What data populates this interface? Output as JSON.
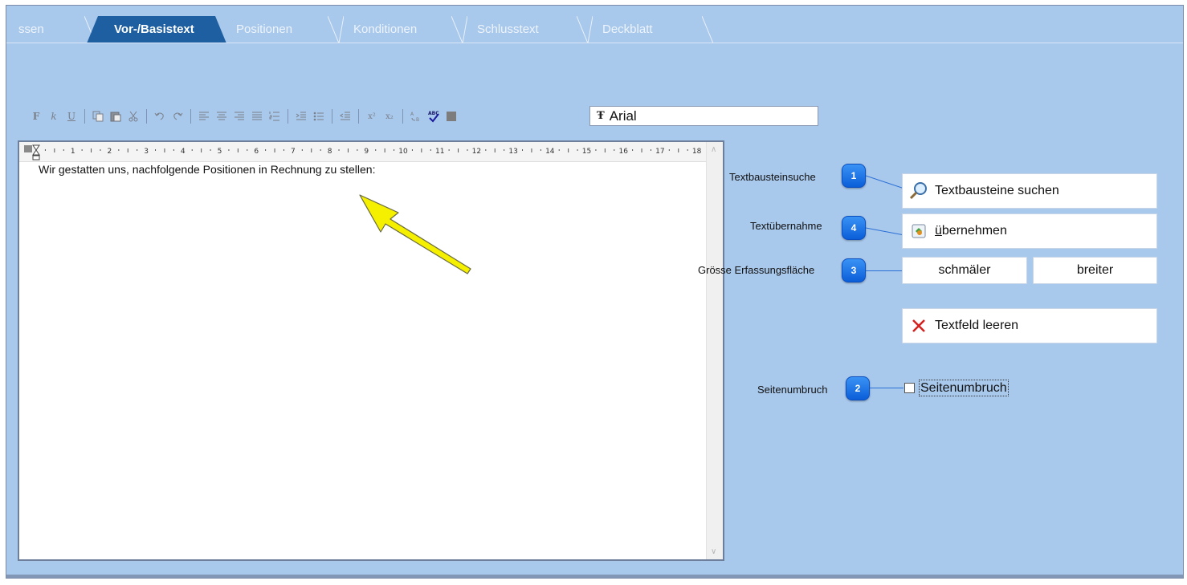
{
  "tabs": [
    {
      "label": "ssen",
      "active": false
    },
    {
      "label": "Vor-/Basistext",
      "active": true
    },
    {
      "label": "Positionen",
      "active": false
    },
    {
      "label": "Konditionen",
      "active": false
    },
    {
      "label": "Schlusstext",
      "active": false
    },
    {
      "label": "Deckblatt",
      "active": false
    }
  ],
  "toolbar": {
    "bold_label": "F",
    "italic_label": "k",
    "underline_label": "U",
    "superscript_label": "x²",
    "subscript_label": "x₂",
    "font_name": "Arial"
  },
  "ruler": {
    "marks": [
      "1",
      "2",
      "3",
      "4",
      "5",
      "6",
      "7",
      "8",
      "9",
      "10",
      "11",
      "12",
      "13",
      "14",
      "15",
      "16",
      "17",
      "18"
    ]
  },
  "editor": {
    "text": "Wir gestatten uns, nachfolgende Positionen in Rechnung zu stellen:"
  },
  "panel": {
    "textbaustein_label": "Textbausteinsuche",
    "textbaustein_badge": "1",
    "textbaustein_button": "Textbausteine suchen",
    "textuebernahme_label": "Textübernahme",
    "textuebernahme_badge": "4",
    "uebernehmen_button_first": "ü",
    "uebernehmen_button_rest": "bernehmen",
    "groesse_label": "Grösse Erfassungsfläche",
    "groesse_badge": "3",
    "schmaeler_button": "schmäler",
    "breiter_button": "breiter",
    "leeren_button": "Textfeld leeren",
    "seitenumbruch_label": "Seitenumbruch",
    "seitenumbruch_badge": "2",
    "seitenumbruch_checkbox": "Seitenumbruch"
  },
  "colors": {
    "background": "#a8c8ec",
    "active_tab": "#1e5fa2",
    "badge": "#0b5ed8",
    "arrow": "#f5f000"
  }
}
